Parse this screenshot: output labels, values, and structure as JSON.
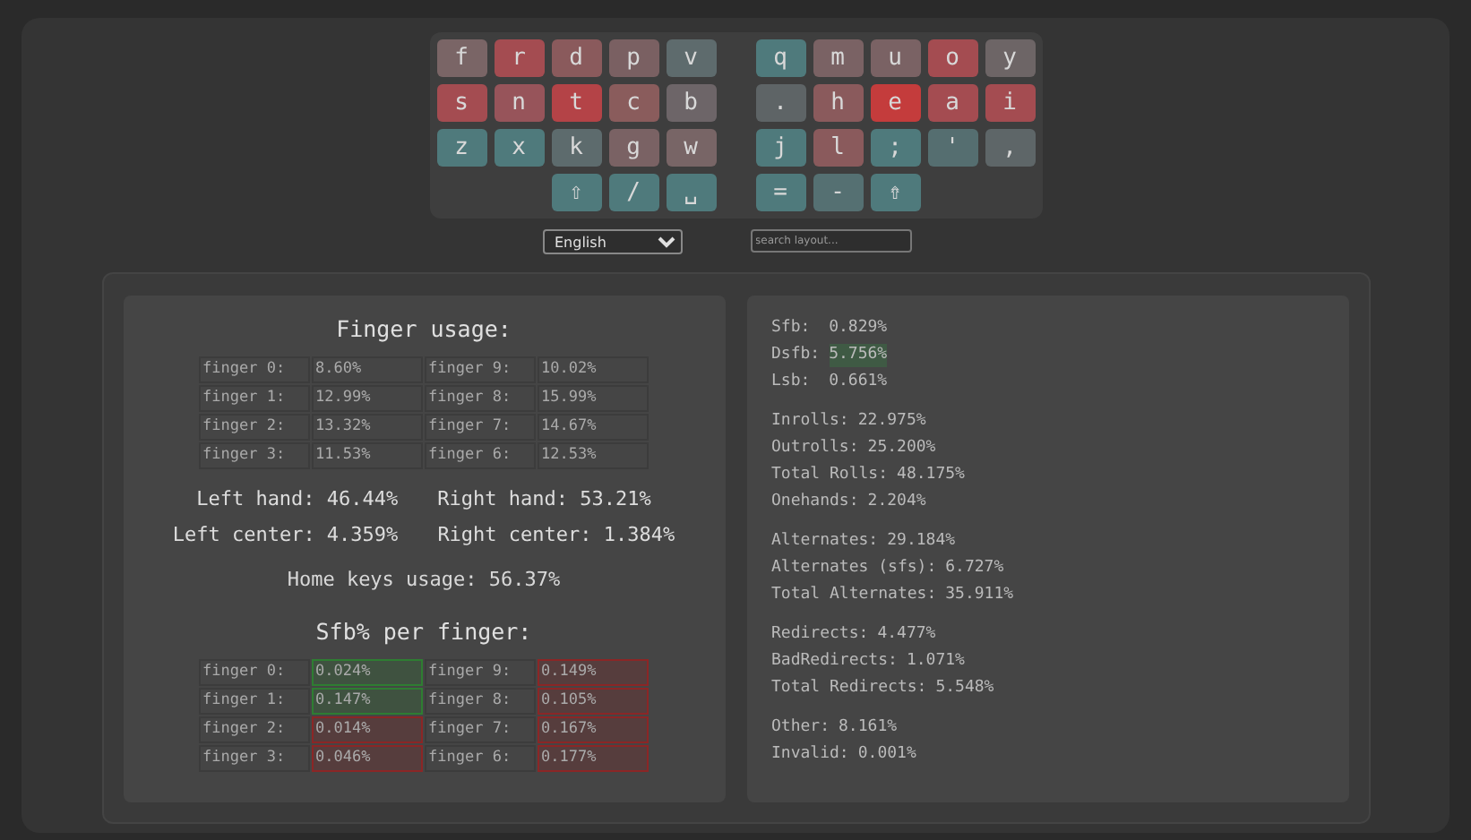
{
  "keyboard": {
    "left": [
      [
        {
          "label": "f",
          "color": "#7a6566"
        },
        {
          "label": "r",
          "color": "#a44c51"
        },
        {
          "label": "d",
          "color": "#8a5a5c"
        },
        {
          "label": "p",
          "color": "#7a6062"
        },
        {
          "label": "v",
          "color": "#5e6b6d"
        }
      ],
      [
        {
          "label": "s",
          "color": "#a44c51"
        },
        {
          "label": "n",
          "color": "#97545a"
        },
        {
          "label": "t",
          "color": "#b44347"
        },
        {
          "label": "c",
          "color": "#8a5c5c"
        },
        {
          "label": "b",
          "color": "#6d6568"
        }
      ],
      [
        {
          "label": "z",
          "color": "#4f7a7c"
        },
        {
          "label": "x",
          "color": "#4f7a7c"
        },
        {
          "label": "k",
          "color": "#5d6b6d"
        },
        {
          "label": "g",
          "color": "#7a6264"
        },
        {
          "label": "w",
          "color": "#786566"
        }
      ],
      [
        {
          "label": "⇧",
          "color": "#4f7a7c"
        },
        {
          "label": "/",
          "color": "#4f7a7c"
        },
        {
          "label": "␣",
          "color": "#4f7a7c"
        }
      ]
    ],
    "right": [
      [
        {
          "label": "q",
          "color": "#4f7a7c"
        },
        {
          "label": "m",
          "color": "#7a6264"
        },
        {
          "label": "u",
          "color": "#7a6264"
        },
        {
          "label": "o",
          "color": "#a44c51"
        },
        {
          "label": "y",
          "color": "#6d6566"
        }
      ],
      [
        {
          "label": ".",
          "color": "#5e6466"
        },
        {
          "label": "h",
          "color": "#8a5a5c"
        },
        {
          "label": "e",
          "color": "#c43c3c"
        },
        {
          "label": "a",
          "color": "#a44c51"
        },
        {
          "label": "i",
          "color": "#a44c51"
        }
      ],
      [
        {
          "label": "j",
          "color": "#4f7a7c"
        },
        {
          "label": "l",
          "color": "#8a5a5c"
        },
        {
          "label": ";",
          "color": "#4f7a7c"
        },
        {
          "label": "'",
          "color": "#556e70"
        },
        {
          "label": ",",
          "color": "#5e6668"
        }
      ],
      [
        {
          "label": "=",
          "color": "#4f7a7c"
        },
        {
          "label": "-",
          "color": "#557072"
        },
        {
          "label": "⇮",
          "color": "#4f7a7c"
        }
      ]
    ]
  },
  "language_select": {
    "value": "English"
  },
  "search": {
    "placeholder": "search layout..."
  },
  "finger_usage": {
    "title": "Finger usage:",
    "rows": [
      [
        {
          "label": "finger 0:",
          "value": "8.60%"
        },
        {
          "label": "finger 9:",
          "value": "10.02%"
        }
      ],
      [
        {
          "label": "finger 1:",
          "value": "12.99%"
        },
        {
          "label": "finger 8:",
          "value": "15.99%"
        }
      ],
      [
        {
          "label": "finger 2:",
          "value": "13.32%"
        },
        {
          "label": "finger 7:",
          "value": "14.67%"
        }
      ],
      [
        {
          "label": "finger 3:",
          "value": "11.53%"
        },
        {
          "label": "finger 6:",
          "value": "12.53%"
        }
      ]
    ],
    "hands": [
      [
        "Left hand: 46.44%",
        "Right hand: 53.21%"
      ],
      [
        "Left center: 4.359%",
        "Right center: 1.384%"
      ]
    ],
    "home_keys": "Home keys usage: 56.37%"
  },
  "sfb_per_finger": {
    "title": "Sfb% per finger:",
    "rows": [
      [
        {
          "label": "finger 0:",
          "value": "0.024%",
          "color": "#2e7d32"
        },
        {
          "label": "finger 9:",
          "value": "0.149%",
          "color": "#8b2626"
        }
      ],
      [
        {
          "label": "finger 1:",
          "value": "0.147%",
          "color": "#2e7d32"
        },
        {
          "label": "finger 8:",
          "value": "0.105%",
          "color": "#8b2626"
        }
      ],
      [
        {
          "label": "finger 2:",
          "value": "0.014%",
          "color": "#8b2626"
        },
        {
          "label": "finger 7:",
          "value": "0.167%",
          "color": "#8b2626"
        }
      ],
      [
        {
          "label": "finger 3:",
          "value": "0.046%",
          "color": "#8b2626"
        },
        {
          "label": "finger 6:",
          "value": "0.177%",
          "color": "#8b2626"
        }
      ]
    ]
  },
  "stats": [
    [
      {
        "label": "Sfb: ",
        "value": "0.829%",
        "highlight": false
      },
      {
        "label": "Dsfb:",
        "value": "5.756%",
        "highlight": true
      },
      {
        "label": "Lsb: ",
        "value": "0.661%",
        "highlight": false
      }
    ],
    [
      {
        "label": "Inrolls:",
        "value": "22.975%",
        "highlight": false
      },
      {
        "label": "Outrolls:",
        "value": "25.200%",
        "highlight": false
      },
      {
        "label": "Total Rolls:",
        "value": "48.175%",
        "highlight": false
      },
      {
        "label": "Onehands:",
        "value": "2.204%",
        "highlight": false
      }
    ],
    [
      {
        "label": "Alternates:",
        "value": "29.184%",
        "highlight": false
      },
      {
        "label": "Alternates (sfs):",
        "value": "6.727%",
        "highlight": false
      },
      {
        "label": "Total Alternates:",
        "value": "35.911%",
        "highlight": false
      }
    ],
    [
      {
        "label": "Redirects:",
        "value": "4.477%",
        "highlight": false
      },
      {
        "label": "BadRedirects:",
        "value": "1.071%",
        "highlight": false
      },
      {
        "label": "Total Redirects:",
        "value": "5.548%",
        "highlight": false
      }
    ],
    [
      {
        "label": "Other:",
        "value": "8.161%",
        "highlight": false
      },
      {
        "label": "Invalid:",
        "value": "0.001%",
        "highlight": false
      }
    ]
  ]
}
